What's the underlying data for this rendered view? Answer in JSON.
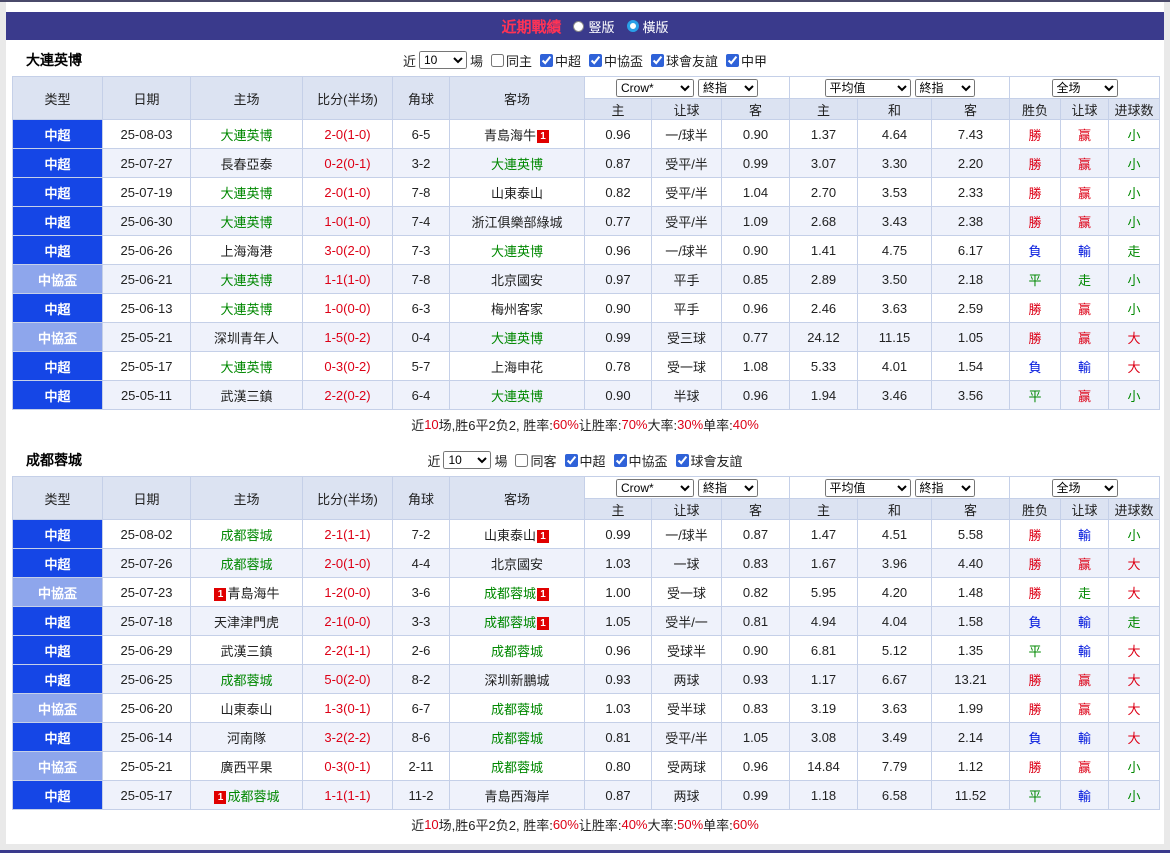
{
  "colors": {
    "bar": "#3a3a8c",
    "title": "#ff3355",
    "csl": "#1546e6",
    "cup": "#8ea6ec",
    "head-bg": "#dce3f2",
    "row-alt": "#eff2fb",
    "border": "#c5d0e8",
    "border-dark": "#9fb0d6",
    "focus": "#008800",
    "red": "#dd0016",
    "blue": "#0016dd",
    "green": "#008800",
    "accent": "#2f62d8"
  },
  "badges": {
    "red_card": "1"
  },
  "header": {
    "title": "近期戰績",
    "options": [
      {
        "label": "豎版",
        "selected": false
      },
      {
        "label": "橫版",
        "selected": true
      }
    ]
  },
  "columns": {
    "main": [
      "类型",
      "日期",
      "主场",
      "比分(半场)",
      "角球",
      "客场"
    ],
    "odds": [
      "主",
      "让球",
      "客",
      "主",
      "和",
      "客",
      "胜负",
      "让球",
      "进球数"
    ]
  },
  "tables": [
    {
      "team": "大連英博",
      "filter": {
        "near_label": "近",
        "count": "10",
        "games_label": "場",
        "checkboxes": [
          {
            "label": "同主",
            "checked": false
          },
          {
            "label": "中超",
            "checked": true
          },
          {
            "label": "中協盃",
            "checked": true
          },
          {
            "label": "球會友誼",
            "checked": true
          },
          {
            "label": "中甲",
            "checked": true
          }
        ]
      },
      "selects": {
        "book": "Crow*",
        "book_index": "終指",
        "avg": "平均值",
        "avg_index": "終指",
        "scope": "全场"
      },
      "rows": [
        {
          "type": "中超",
          "style": "csl",
          "date": "25-08-03",
          "home": {
            "name": "大連英博",
            "focus": true
          },
          "score": "2-0(1-0)",
          "corner": "6-5",
          "away": {
            "name": "青島海牛",
            "card_after": true
          },
          "odds": [
            "0.96",
            "一/球半",
            "0.90",
            "1.37",
            "4.64",
            "7.43"
          ],
          "results": [
            [
              "勝",
              "r"
            ],
            [
              "赢",
              "r"
            ],
            [
              "小",
              "g"
            ]
          ]
        },
        {
          "type": "中超",
          "style": "csl",
          "date": "25-07-27",
          "home": {
            "name": "長春亞泰"
          },
          "score": "0-2(0-1)",
          "corner": "3-2",
          "away": {
            "name": "大連英博",
            "focus": true
          },
          "odds": [
            "0.87",
            "受平/半",
            "0.99",
            "3.07",
            "3.30",
            "2.20"
          ],
          "results": [
            [
              "勝",
              "r"
            ],
            [
              "赢",
              "r"
            ],
            [
              "小",
              "g"
            ]
          ]
        },
        {
          "type": "中超",
          "style": "csl",
          "date": "25-07-19",
          "home": {
            "name": "大連英博",
            "focus": true
          },
          "score": "2-0(1-0)",
          "corner": "7-8",
          "away": {
            "name": "山東泰山"
          },
          "odds": [
            "0.82",
            "受平/半",
            "1.04",
            "2.70",
            "3.53",
            "2.33"
          ],
          "results": [
            [
              "勝",
              "r"
            ],
            [
              "赢",
              "r"
            ],
            [
              "小",
              "g"
            ]
          ]
        },
        {
          "type": "中超",
          "style": "csl",
          "date": "25-06-30",
          "home": {
            "name": "大連英博",
            "focus": true
          },
          "score": "1-0(1-0)",
          "corner": "7-4",
          "away": {
            "name": "浙江俱樂部綠城"
          },
          "odds": [
            "0.77",
            "受平/半",
            "1.09",
            "2.68",
            "3.43",
            "2.38"
          ],
          "results": [
            [
              "勝",
              "r"
            ],
            [
              "赢",
              "r"
            ],
            [
              "小",
              "g"
            ]
          ]
        },
        {
          "type": "中超",
          "style": "csl",
          "date": "25-06-26",
          "home": {
            "name": "上海海港"
          },
          "score": "3-0(2-0)",
          "corner": "7-3",
          "away": {
            "name": "大連英博",
            "focus": true
          },
          "odds": [
            "0.96",
            "一/球半",
            "0.90",
            "1.41",
            "4.75",
            "6.17"
          ],
          "results": [
            [
              "負",
              "b"
            ],
            [
              "輸",
              "b"
            ],
            [
              "走",
              "g"
            ]
          ]
        },
        {
          "type": "中協盃",
          "style": "cup",
          "date": "25-06-21",
          "home": {
            "name": "大連英博",
            "focus": true
          },
          "score": "1-1(1-0)",
          "corner": "7-8",
          "away": {
            "name": "北京國安"
          },
          "odds": [
            "0.97",
            "平手",
            "0.85",
            "2.89",
            "3.50",
            "2.18"
          ],
          "results": [
            [
              "平",
              "g"
            ],
            [
              "走",
              "g"
            ],
            [
              "小",
              "g"
            ]
          ]
        },
        {
          "type": "中超",
          "style": "csl",
          "date": "25-06-13",
          "home": {
            "name": "大連英博",
            "focus": true
          },
          "score": "1-0(0-0)",
          "corner": "6-3",
          "away": {
            "name": "梅州客家"
          },
          "odds": [
            "0.90",
            "平手",
            "0.96",
            "2.46",
            "3.63",
            "2.59"
          ],
          "results": [
            [
              "勝",
              "r"
            ],
            [
              "赢",
              "r"
            ],
            [
              "小",
              "g"
            ]
          ]
        },
        {
          "type": "中協盃",
          "style": "cup",
          "date": "25-05-21",
          "home": {
            "name": "深圳青年人"
          },
          "score": "1-5(0-2)",
          "corner": "0-4",
          "away": {
            "name": "大連英博",
            "focus": true
          },
          "odds": [
            "0.99",
            "受三球",
            "0.77",
            "24.12",
            "11.15",
            "1.05"
          ],
          "results": [
            [
              "勝",
              "r"
            ],
            [
              "赢",
              "r"
            ],
            [
              "大",
              "r"
            ]
          ]
        },
        {
          "type": "中超",
          "style": "csl",
          "date": "25-05-17",
          "home": {
            "name": "大連英博",
            "focus": true
          },
          "score": "0-3(0-2)",
          "corner": "5-7",
          "away": {
            "name": "上海申花"
          },
          "odds": [
            "0.78",
            "受一球",
            "1.08",
            "5.33",
            "4.01",
            "1.54"
          ],
          "results": [
            [
              "負",
              "b"
            ],
            [
              "輸",
              "b"
            ],
            [
              "大",
              "r"
            ]
          ]
        },
        {
          "type": "中超",
          "style": "csl",
          "date": "25-05-11",
          "home": {
            "name": "武漢三鎮"
          },
          "score": "2-2(0-2)",
          "corner": "6-4",
          "away": {
            "name": "大連英博",
            "focus": true
          },
          "odds": [
            "0.90",
            "半球",
            "0.96",
            "1.94",
            "3.46",
            "3.56"
          ],
          "results": [
            [
              "平",
              "g"
            ],
            [
              "赢",
              "r"
            ],
            [
              "小",
              "g"
            ]
          ]
        }
      ],
      "summary": [
        [
          "近",
          "k"
        ],
        [
          "10",
          "r"
        ],
        [
          "场,胜6平2负2, 胜率:",
          "k"
        ],
        [
          "60%",
          "r"
        ],
        [
          " 让胜率:",
          "k"
        ],
        [
          "70%",
          "r"
        ],
        [
          " 大率:",
          "k"
        ],
        [
          "30%",
          "r"
        ],
        [
          " 单率:",
          "k"
        ],
        [
          "40%",
          "r"
        ]
      ]
    },
    {
      "team": "成都蓉城",
      "filter": {
        "near_label": "近",
        "count": "10",
        "games_label": "場",
        "checkboxes": [
          {
            "label": "同客",
            "checked": false
          },
          {
            "label": "中超",
            "checked": true
          },
          {
            "label": "中協盃",
            "checked": true
          },
          {
            "label": "球會友誼",
            "checked": true
          }
        ]
      },
      "selects": {
        "book": "Crow*",
        "book_index": "終指",
        "avg": "平均值",
        "avg_index": "終指",
        "scope": "全场"
      },
      "rows": [
        {
          "type": "中超",
          "style": "csl",
          "date": "25-08-02",
          "home": {
            "name": "成都蓉城",
            "focus": true
          },
          "score": "2-1(1-1)",
          "corner": "7-2",
          "away": {
            "name": "山東泰山",
            "card_after": true
          },
          "odds": [
            "0.99",
            "一/球半",
            "0.87",
            "1.47",
            "4.51",
            "5.58"
          ],
          "results": [
            [
              "勝",
              "r"
            ],
            [
              "輸",
              "b"
            ],
            [
              "小",
              "g"
            ]
          ]
        },
        {
          "type": "中超",
          "style": "csl",
          "date": "25-07-26",
          "home": {
            "name": "成都蓉城",
            "focus": true
          },
          "score": "2-0(1-0)",
          "corner": "4-4",
          "away": {
            "name": "北京國安"
          },
          "odds": [
            "1.03",
            "一球",
            "0.83",
            "1.67",
            "3.96",
            "4.40"
          ],
          "results": [
            [
              "勝",
              "r"
            ],
            [
              "赢",
              "r"
            ],
            [
              "大",
              "r"
            ]
          ]
        },
        {
          "type": "中協盃",
          "style": "cup",
          "date": "25-07-23",
          "home": {
            "name": "青島海牛",
            "card_before": true
          },
          "score": "1-2(0-0)",
          "corner": "3-6",
          "away": {
            "name": "成都蓉城",
            "focus": true,
            "card_after": true
          },
          "odds": [
            "1.00",
            "受一球",
            "0.82",
            "5.95",
            "4.20",
            "1.48"
          ],
          "results": [
            [
              "勝",
              "r"
            ],
            [
              "走",
              "g"
            ],
            [
              "大",
              "r"
            ]
          ]
        },
        {
          "type": "中超",
          "style": "csl",
          "date": "25-07-18",
          "home": {
            "name": "天津津門虎"
          },
          "score": "2-1(0-0)",
          "corner": "3-3",
          "away": {
            "name": "成都蓉城",
            "focus": true,
            "card_after": true
          },
          "odds": [
            "1.05",
            "受半/一",
            "0.81",
            "4.94",
            "4.04",
            "1.58"
          ],
          "results": [
            [
              "負",
              "b"
            ],
            [
              "輸",
              "b"
            ],
            [
              "走",
              "g"
            ]
          ]
        },
        {
          "type": "中超",
          "style": "csl",
          "date": "25-06-29",
          "home": {
            "name": "武漢三鎮"
          },
          "score": "2-2(1-1)",
          "corner": "2-6",
          "away": {
            "name": "成都蓉城",
            "focus": true
          },
          "odds": [
            "0.96",
            "受球半",
            "0.90",
            "6.81",
            "5.12",
            "1.35"
          ],
          "results": [
            [
              "平",
              "g"
            ],
            [
              "輸",
              "b"
            ],
            [
              "大",
              "r"
            ]
          ]
        },
        {
          "type": "中超",
          "style": "csl",
          "date": "25-06-25",
          "home": {
            "name": "成都蓉城",
            "focus": true
          },
          "score": "5-0(2-0)",
          "corner": "8-2",
          "away": {
            "name": "深圳新鵬城"
          },
          "odds": [
            "0.93",
            "两球",
            "0.93",
            "1.17",
            "6.67",
            "13.21"
          ],
          "results": [
            [
              "勝",
              "r"
            ],
            [
              "赢",
              "r"
            ],
            [
              "大",
              "r"
            ]
          ]
        },
        {
          "type": "中協盃",
          "style": "cup",
          "date": "25-06-20",
          "home": {
            "name": "山東泰山"
          },
          "score": "1-3(0-1)",
          "corner": "6-7",
          "away": {
            "name": "成都蓉城",
            "focus": true
          },
          "odds": [
            "1.03",
            "受半球",
            "0.83",
            "3.19",
            "3.63",
            "1.99"
          ],
          "results": [
            [
              "勝",
              "r"
            ],
            [
              "赢",
              "r"
            ],
            [
              "大",
              "r"
            ]
          ]
        },
        {
          "type": "中超",
          "style": "csl",
          "date": "25-06-14",
          "home": {
            "name": "河南隊"
          },
          "score": "3-2(2-2)",
          "corner": "8-6",
          "away": {
            "name": "成都蓉城",
            "focus": true
          },
          "odds": [
            "0.81",
            "受平/半",
            "1.05",
            "3.08",
            "3.49",
            "2.14"
          ],
          "results": [
            [
              "負",
              "b"
            ],
            [
              "輸",
              "b"
            ],
            [
              "大",
              "r"
            ]
          ]
        },
        {
          "type": "中協盃",
          "style": "cup",
          "date": "25-05-21",
          "home": {
            "name": "廣西平果"
          },
          "score": "0-3(0-1)",
          "corner": "2-11",
          "away": {
            "name": "成都蓉城",
            "focus": true
          },
          "odds": [
            "0.80",
            "受两球",
            "0.96",
            "14.84",
            "7.79",
            "1.12"
          ],
          "results": [
            [
              "勝",
              "r"
            ],
            [
              "赢",
              "r"
            ],
            [
              "小",
              "g"
            ]
          ]
        },
        {
          "type": "中超",
          "style": "csl",
          "date": "25-05-17",
          "home": {
            "name": "成都蓉城",
            "focus": true,
            "card_before": true
          },
          "score": "1-1(1-1)",
          "corner": "11-2",
          "away": {
            "name": "青島西海岸"
          },
          "odds": [
            "0.87",
            "两球",
            "0.99",
            "1.18",
            "6.58",
            "11.52"
          ],
          "results": [
            [
              "平",
              "g"
            ],
            [
              "輸",
              "b"
            ],
            [
              "小",
              "g"
            ]
          ]
        }
      ],
      "summary": [
        [
          "近",
          "k"
        ],
        [
          "10",
          "r"
        ],
        [
          "场,胜6平2负2, 胜率:",
          "k"
        ],
        [
          "60%",
          "r"
        ],
        [
          " 让胜率:",
          "k"
        ],
        [
          "40%",
          "r"
        ],
        [
          " 大率:",
          "k"
        ],
        [
          "50%",
          "r"
        ],
        [
          " 单率:",
          "k"
        ],
        [
          "60%",
          "r"
        ]
      ]
    }
  ]
}
